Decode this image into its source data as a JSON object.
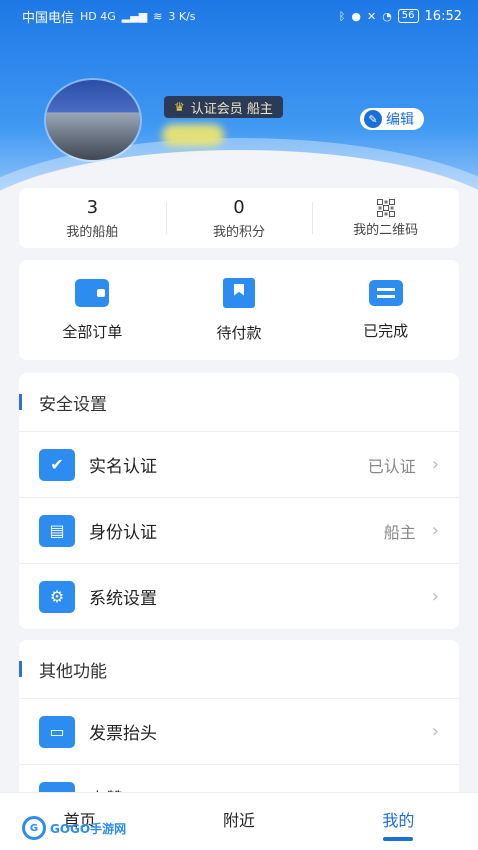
{
  "status_bar": {
    "carrier": "中国电信",
    "network": "HD 4G",
    "speed": "3 K/s",
    "battery": "56",
    "time": "16:52"
  },
  "profile": {
    "badge": "认证会员  船主",
    "edit_label": "编辑"
  },
  "stats": [
    {
      "value": "3",
      "label": "我的船舶"
    },
    {
      "value": "0",
      "label": "我的积分"
    },
    {
      "value": "",
      "label": "我的二维码"
    }
  ],
  "orders": [
    {
      "label": "全部订单",
      "icon": "wallet-icon"
    },
    {
      "label": "待付款",
      "icon": "payment-icon"
    },
    {
      "label": "已完成",
      "icon": "card-icon"
    }
  ],
  "security": {
    "title": "安全设置",
    "items": [
      {
        "label": "实名认证",
        "value": "已认证",
        "icon": "user-check-icon"
      },
      {
        "label": "身份认证",
        "value": "船主",
        "icon": "id-card-icon"
      },
      {
        "label": "系统设置",
        "value": "",
        "icon": "gear-icon"
      }
    ]
  },
  "other": {
    "title": "其他功能",
    "items": [
      {
        "label": "发票抬头",
        "icon": "invoice-icon"
      },
      {
        "label": "点赞",
        "icon": "like-icon"
      }
    ]
  },
  "tabs": [
    {
      "label": "首页"
    },
    {
      "label": "附近"
    },
    {
      "label": "我的"
    }
  ],
  "watermark": "GOGO手游网",
  "colors": {
    "accent": "#1a6fd9",
    "icon_blue": "#2d8cf0",
    "badge_bg": "#2b3b57"
  }
}
